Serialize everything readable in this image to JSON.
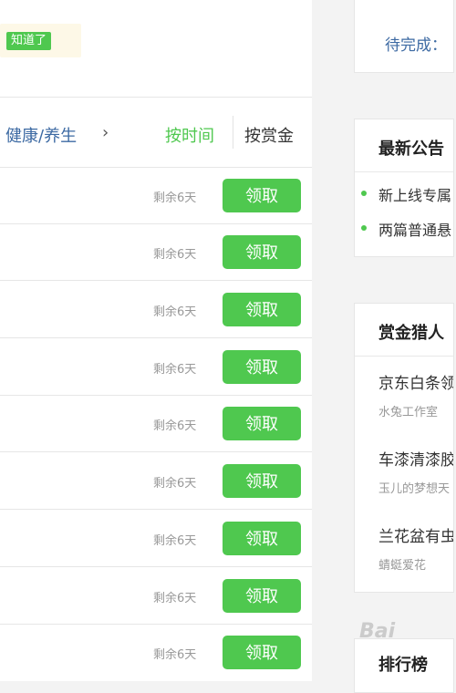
{
  "notice": {
    "button_label": "知道了"
  },
  "filter": {
    "category": "健康/养生",
    "chevron": "›",
    "sort_time": "按时间",
    "sort_money": "按赏金"
  },
  "tasks": [
    {
      "remaining": "剩余6天",
      "button": "领取"
    },
    {
      "remaining": "剩余6天",
      "button": "领取"
    },
    {
      "remaining": "剩余6天",
      "button": "领取"
    },
    {
      "remaining": "剩余6天",
      "button": "领取"
    },
    {
      "remaining": "剩余6天",
      "button": "领取"
    },
    {
      "remaining": "剩余6天",
      "button": "领取"
    },
    {
      "remaining": "剩余6天",
      "button": "领取"
    },
    {
      "remaining": "剩余6天",
      "button": "领取"
    },
    {
      "remaining": "剩余6天",
      "button": "领取"
    }
  ],
  "sidebar": {
    "pending_label": "待完成：",
    "news": {
      "title": "最新公告",
      "items": [
        "新上线专属",
        "两篇普通悬"
      ]
    },
    "hunters": {
      "title": "赏金猎人",
      "items": [
        {
          "title": "京东白条领",
          "user": "水兔工作室"
        },
        {
          "title": "车漆清漆胶",
          "user": "玉儿的梦想天"
        },
        {
          "title": "兰花盆有虫",
          "user": "蜻蜓爱花"
        }
      ]
    },
    "rank": {
      "title": "排行榜"
    }
  },
  "watermark": "Bai"
}
